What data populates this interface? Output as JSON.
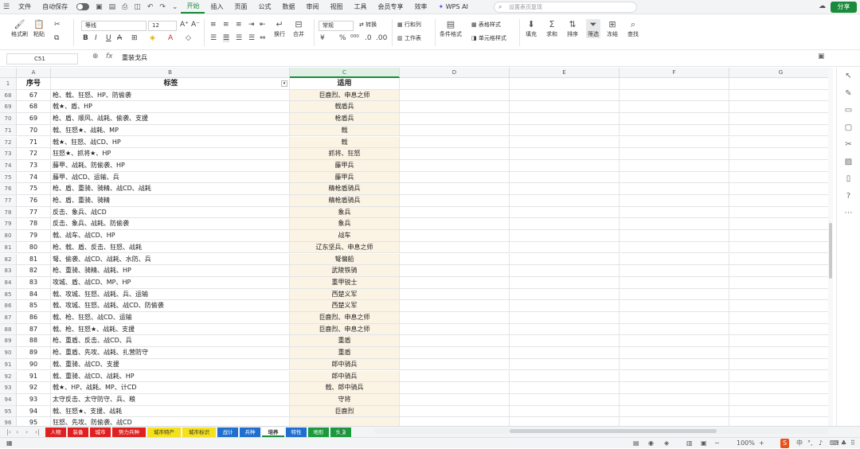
{
  "menubar": {
    "file": "文件",
    "autosave": "自动保存",
    "tabs": [
      "开始",
      "插入",
      "页面",
      "公式",
      "数据",
      "审阅",
      "视图",
      "工具",
      "会员专享",
      "效率"
    ],
    "active_tab": "开始",
    "wps_ai": "WPS AI",
    "search_placeholder": "设置表页复现",
    "share": "分享"
  },
  "ribbon": {
    "format_painter": "格式刷",
    "paste": "粘贴",
    "font_name": "等线",
    "font_size": "12",
    "wrap": "换行",
    "merge": "合并",
    "number_format": "常规",
    "convert": "转换",
    "row_col": "行和列",
    "worksheet": "工作表",
    "cond_format": "条件格式",
    "table_style": "表格样式",
    "cell_style": "单元格样式",
    "fill": "填充",
    "sum": "求和",
    "sort": "排序",
    "filter": "筛选",
    "freeze": "冻结",
    "find": "查找"
  },
  "formula_bar": {
    "cell_ref": "C51",
    "content": "重装戈兵"
  },
  "columns": [
    "A",
    "B",
    "C",
    "D",
    "E",
    "F",
    "G"
  ],
  "header_row": {
    "row": "1",
    "a": "序号",
    "b": "标签",
    "c": "适用"
  },
  "rows": [
    {
      "row": "68",
      "a": "67",
      "b": "枪、戟、狂怒、HP、防偷袭",
      "c": "巨鹿烈、申息之师"
    },
    {
      "row": "69",
      "a": "68",
      "b": "戟★、盾、HP",
      "c": "戟盾兵"
    },
    {
      "row": "70",
      "a": "69",
      "b": "枪、盾、顺风、战耗、偷袭、支援",
      "c": "枪盾兵"
    },
    {
      "row": "71",
      "a": "70",
      "b": "戟、狂怒★、战耗、MP",
      "c": "戟"
    },
    {
      "row": "72",
      "a": "71",
      "b": "戟★、狂怒、战CD、HP",
      "c": "戟"
    },
    {
      "row": "73",
      "a": "72",
      "b": "狂怒★、抓将★、HP",
      "c": "抓将、狂怒"
    },
    {
      "row": "74",
      "a": "73",
      "b": "藤甲、战耗、防偷袭、HP",
      "c": "藤甲兵"
    },
    {
      "row": "75",
      "a": "74",
      "b": "藤甲、战CD、运输、兵",
      "c": "藤甲兵"
    },
    {
      "row": "76",
      "a": "75",
      "b": "枪、盾、重骑、骑精、战CD、战耗",
      "c": "精枪盾骑兵"
    },
    {
      "row": "77",
      "a": "76",
      "b": "枪、盾、重骑、骑精",
      "c": "精枪盾骑兵"
    },
    {
      "row": "78",
      "a": "77",
      "b": "反击、象兵、战CD",
      "c": "象兵"
    },
    {
      "row": "79",
      "a": "78",
      "b": "反击、象兵、战耗、防偷袭",
      "c": "象兵"
    },
    {
      "row": "80",
      "a": "79",
      "b": "戟、战车、战CD、HP",
      "c": "战车"
    },
    {
      "row": "81",
      "a": "80",
      "b": "枪、戟、盾、反击、狂怒、战耗",
      "c": "辽东坚兵、申息之师"
    },
    {
      "row": "82",
      "a": "81",
      "b": "弩、偷袭、战CD、战耗、水防、兵",
      "c": "弩偏船"
    },
    {
      "row": "83",
      "a": "82",
      "b": "枪、重骑、骑精、战耗、HP",
      "c": "武陵铁骑"
    },
    {
      "row": "84",
      "a": "83",
      "b": "攻城、盾、战CD、MP、HP",
      "c": "重甲锐士"
    },
    {
      "row": "85",
      "a": "84",
      "b": "戟、攻城、狂怒、战耗、兵、运输",
      "c": "西楚义军"
    },
    {
      "row": "86",
      "a": "85",
      "b": "戟、攻城、狂怒、战耗、战CD、防偷袭",
      "c": "西楚义军"
    },
    {
      "row": "87",
      "a": "86",
      "b": "戟、枪、狂怒、战CD、运输",
      "c": "巨鹿烈、申息之师"
    },
    {
      "row": "88",
      "a": "87",
      "b": "戟、枪、狂怒★、战耗、支援",
      "c": "巨鹿烈、申息之师"
    },
    {
      "row": "89",
      "a": "88",
      "b": "枪、重盾、反击、战CD、兵",
      "c": "重盾"
    },
    {
      "row": "90",
      "a": "89",
      "b": "枪、重盾、先攻、战耗、扎营防守",
      "c": "重盾"
    },
    {
      "row": "91",
      "a": "90",
      "b": "戟、重骑、战CD、支援",
      "c": "郎中骑兵"
    },
    {
      "row": "92",
      "a": "91",
      "b": "戟、重骑、战CD、战耗、HP",
      "c": "郎中骑兵"
    },
    {
      "row": "93",
      "a": "92",
      "b": "戟★、HP、战耗、MP、计CD",
      "c": "戟、郎中骑兵"
    },
    {
      "row": "94",
      "a": "93",
      "b": "太守反击、太守防守、兵、粮",
      "c": "守将"
    },
    {
      "row": "95",
      "a": "94",
      "b": "戟、狂怒★、支援、战耗",
      "c": "巨鹿烈"
    },
    {
      "row": "96",
      "a": "95",
      "b": "狂怒、先攻、防偷袭、战CD",
      "c": ""
    }
  ],
  "sheet_tabs": [
    {
      "label": "人物",
      "color": "#e02020"
    },
    {
      "label": "装备",
      "color": "#e02020"
    },
    {
      "label": "城市",
      "color": "#e02020"
    },
    {
      "label": "势力兵种",
      "color": "#e02020"
    },
    {
      "label": "城市特产",
      "color": "#f5e11a"
    },
    {
      "label": "城市标识",
      "color": "#f5e11a"
    },
    {
      "label": "战计",
      "color": "#1f6fd1"
    },
    {
      "label": "兵种",
      "color": "#1f6fd1"
    },
    {
      "label": "培养",
      "color": "#ffffff"
    },
    {
      "label": "特性",
      "color": "#1f6fd1"
    },
    {
      "label": "地形",
      "color": "#1a9a3c"
    },
    {
      "label": "头像",
      "color": "#1a9a3c"
    }
  ],
  "status": {
    "zoom": "100%"
  }
}
